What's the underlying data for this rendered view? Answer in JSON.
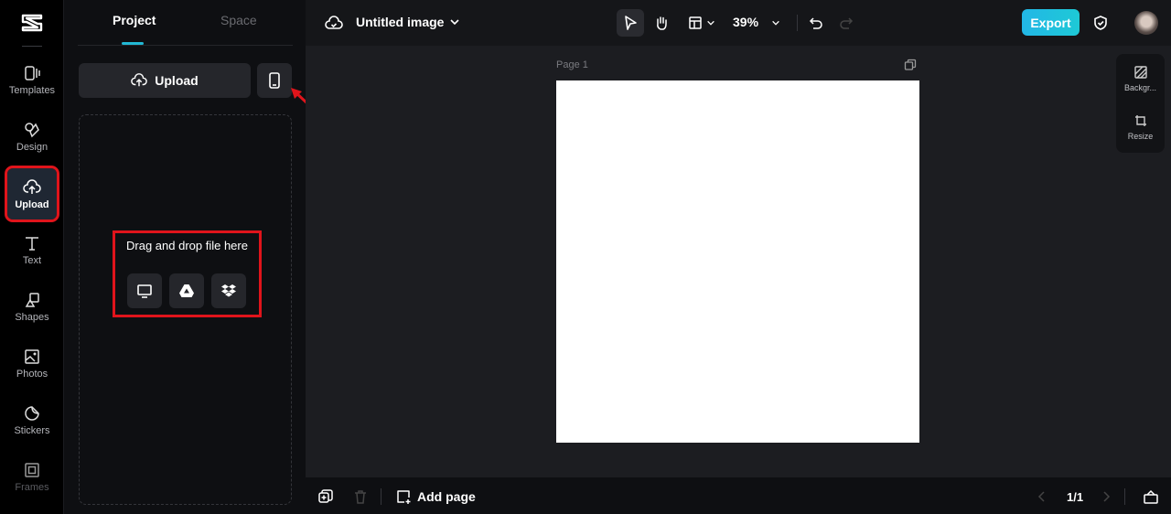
{
  "rail": {
    "items": [
      {
        "label": "Templates",
        "icon": "templates-icon"
      },
      {
        "label": "Design",
        "icon": "design-icon"
      },
      {
        "label": "Upload",
        "icon": "upload-cloud-icon",
        "active": true
      },
      {
        "label": "Text",
        "icon": "text-icon"
      },
      {
        "label": "Shapes",
        "icon": "shapes-icon"
      },
      {
        "label": "Photos",
        "icon": "photos-icon"
      },
      {
        "label": "Stickers",
        "icon": "stickers-icon"
      },
      {
        "label": "Frames",
        "icon": "frames-icon"
      }
    ]
  },
  "panel": {
    "tabs": [
      {
        "label": "Project",
        "active": true
      },
      {
        "label": "Space",
        "active": false
      }
    ],
    "upload_label": "Upload",
    "dropzone_text": "Drag and drop file here",
    "sources": [
      "computer-icon",
      "google-drive-icon",
      "dropbox-icon"
    ]
  },
  "topbar": {
    "title": "Untitled image",
    "zoom": "39%",
    "export_label": "Export"
  },
  "canvas": {
    "page_label": "Page 1",
    "right_tools": [
      {
        "label": "Backgr..."
      },
      {
        "label": "Resize"
      }
    ]
  },
  "bottombar": {
    "add_page_label": "Add page",
    "pager": "1/1"
  },
  "colors": {
    "accent": "#22b8d4",
    "highlight": "#e0141b",
    "export": "#1ec0e0"
  }
}
